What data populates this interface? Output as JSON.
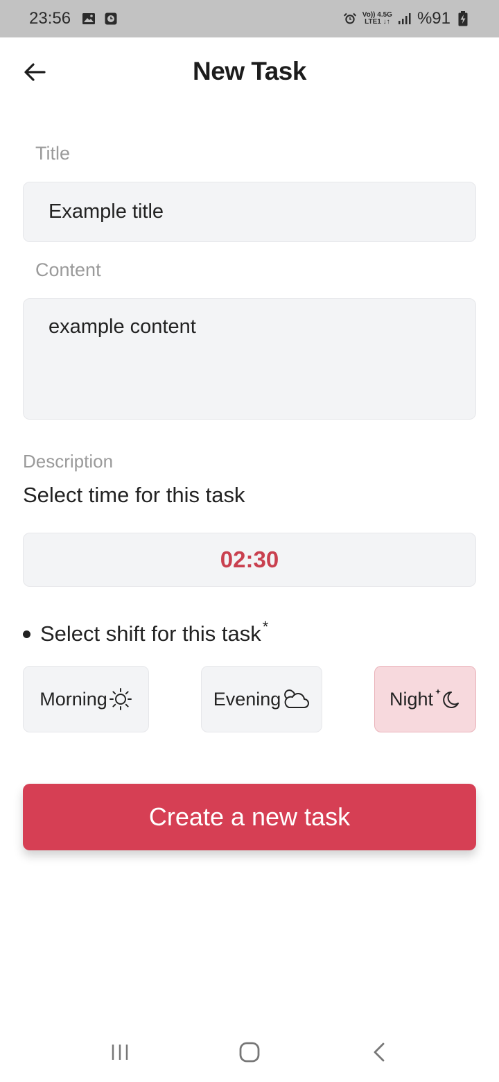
{
  "status_bar": {
    "time": "23:56",
    "net_top": "Vo)) 4.5G",
    "net_bottom": "LTE1 ↓↑",
    "battery": "%91",
    "icons": [
      "image-icon",
      "clock-app-icon",
      "alarm-icon",
      "signal-icon",
      "battery-charging-icon"
    ]
  },
  "header": {
    "title": "New Task",
    "back_icon": "arrow-left-icon"
  },
  "form": {
    "title_label": "Title",
    "title_value": "Example title",
    "content_label": "Content",
    "content_value": "example content",
    "description_label": "Description",
    "description_text": "Select time for this task",
    "time_value": "02:30",
    "shift_label": "Select shift for this task",
    "shift_required_mark": "*",
    "shifts": [
      {
        "label": "Morning",
        "icon": "sun-icon",
        "selected": false
      },
      {
        "label": "Evening",
        "icon": "cloud-icon",
        "selected": false
      },
      {
        "label": "Night",
        "icon": "moon-star-icon",
        "selected": true
      }
    ],
    "submit_label": "Create a new task"
  },
  "nav_bar": {
    "items": [
      "recent-apps-icon",
      "home-icon",
      "back-icon"
    ]
  },
  "colors": {
    "accent": "#d63f54",
    "time_text": "#c9404f",
    "selected_shift_bg": "#f7d9dd",
    "input_bg": "#f3f4f6",
    "status_bar_bg": "#c2c2c2"
  }
}
